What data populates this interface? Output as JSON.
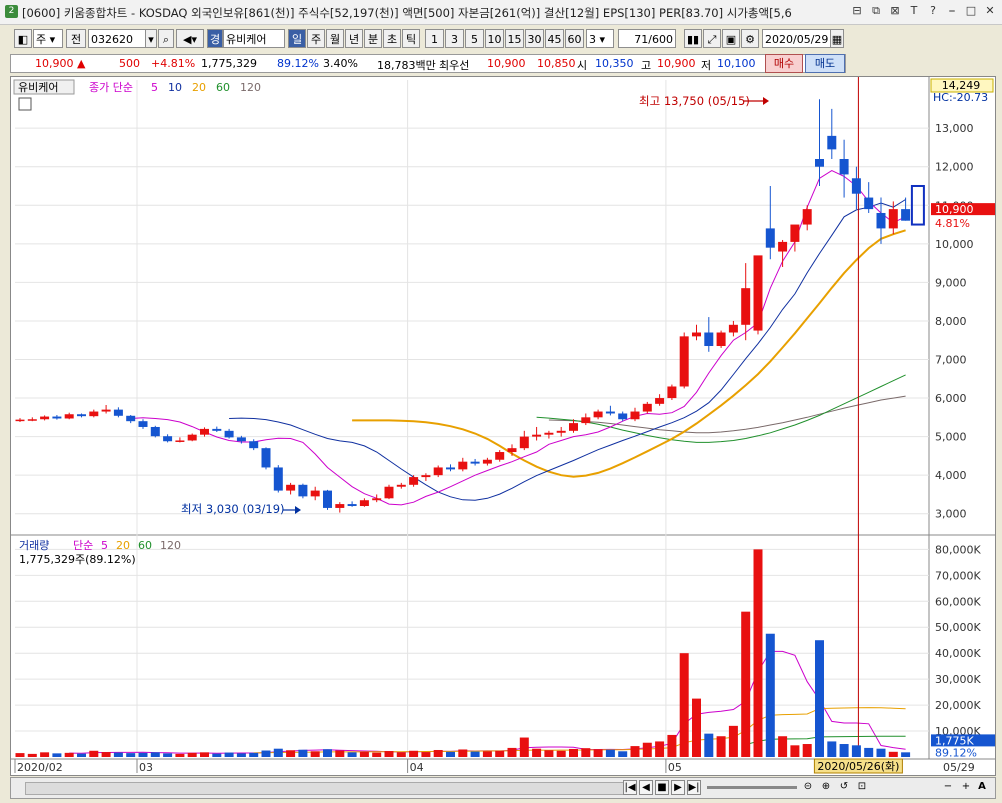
{
  "window": {
    "badge": "2",
    "title": "[0600] 키움종합차트 - KOSDAQ 외국인보유[861(천)] 주식수[52,197(천)] 액면[500] 자본금[261(억)] 결산[12월] EPS[130] PER[83.70] 시가총액[5,6",
    "buttons": [
      "⊟",
      "⧉",
      "⊠",
      "T",
      "?",
      "⎯",
      "□",
      "✕"
    ]
  },
  "toolbar": {
    "period_select": "주",
    "prev_label": "전",
    "code": "032620",
    "name": "유비케어",
    "name_prefix": "경",
    "timeframes": [
      "일",
      "주",
      "월",
      "년",
      "분",
      "초",
      "틱"
    ],
    "minutes": [
      "1",
      "3",
      "5",
      "10",
      "15",
      "30",
      "45",
      "60"
    ],
    "minute_value": "3",
    "count": "71",
    "count_max": "/600",
    "date": "2020/05/29"
  },
  "quote": {
    "price": "10,900",
    "arrow": "▲",
    "change": "500",
    "change_pct": "+4.81%",
    "volume": "1,775,329",
    "volume_ratio": "89.12%",
    "turnover": "3.40%",
    "amount": "18,783백만",
    "best_label": "최우선",
    "ask": "10,900",
    "bid": "10,850",
    "open_label": "시",
    "open": "10,350",
    "high_label": "고",
    "high": "10,900",
    "low_label": "저",
    "low": "10,100",
    "buy_label": "매수",
    "sell_label": "매도"
  },
  "price_panel": {
    "stock_tag": "유비케어",
    "ma_label": "종가 단순",
    "ma_periods": [
      "5",
      "10",
      "20",
      "60",
      "120"
    ],
    "ma_colors": [
      "#cc00cc",
      "#1030a0",
      "#e8a000",
      "#20902c",
      "#7a6a6a"
    ],
    "right_top": "14,249",
    "right_hc": "HC:-20.73",
    "current_tag": "10,900",
    "current_pct": "4.81%",
    "y_ticks": [
      "13,000",
      "12,000",
      "11,000",
      "10,000",
      "9,000",
      "8,000",
      "7,000",
      "6,000",
      "5,000",
      "4,000",
      "3,000"
    ],
    "high_note": "최고 13,750 (05/15)",
    "low_note": "최저 3,030 (03/19)"
  },
  "volume_panel": {
    "label": "거래량",
    "ma_label": "단순",
    "ma_periods": [
      "5",
      "20",
      "60",
      "120"
    ],
    "value_note": "1,775,329주(89.12%)",
    "y_ticks": [
      "80,000K",
      "70,000K",
      "60,000K",
      "50,000K",
      "40,000K",
      "30,000K",
      "20,000K",
      "10,000K"
    ],
    "current_tag": "1,775K",
    "current_pct": "89.12%"
  },
  "x_axis": {
    "labels": [
      "2020/02",
      "03",
      "04",
      "05"
    ],
    "crosshair_date": "2020/05/26(화)",
    "right_date": "05/29"
  },
  "colors": {
    "up": "#e81010",
    "down": "#1555d0",
    "crosshair": "#c00000"
  },
  "chart_data": {
    "type": "candlestick",
    "candles": [
      [
        5430,
        5480,
        5380,
        5440,
        1.5
      ],
      [
        5440,
        5500,
        5400,
        5450,
        1.2
      ],
      [
        5450,
        5550,
        5420,
        5520,
        1.8
      ],
      [
        5520,
        5560,
        5440,
        5470,
        1.4
      ],
      [
        5470,
        5620,
        5450,
        5580,
        1.6
      ],
      [
        5580,
        5600,
        5500,
        5530,
        1.3
      ],
      [
        5530,
        5700,
        5500,
        5650,
        2.4
      ],
      [
        5650,
        5820,
        5600,
        5700,
        1.9
      ],
      [
        5700,
        5760,
        5500,
        5540,
        1.7
      ],
      [
        5540,
        5560,
        5350,
        5400,
        1.5
      ],
      [
        5400,
        5450,
        5200,
        5250,
        1.6
      ],
      [
        5250,
        5280,
        4980,
        5010,
        1.8
      ],
      [
        5010,
        5060,
        4850,
        4880,
        1.4
      ],
      [
        4880,
        4980,
        4850,
        4900,
        1.2
      ],
      [
        4900,
        5080,
        4880,
        5050,
        1.6
      ],
      [
        5050,
        5240,
        5000,
        5200,
        1.8
      ],
      [
        5200,
        5260,
        5120,
        5150,
        1.3
      ],
      [
        5150,
        5200,
        4950,
        4980,
        1.7
      ],
      [
        4980,
        5020,
        4820,
        4880,
        1.4
      ],
      [
        4880,
        4930,
        4650,
        4700,
        1.6
      ],
      [
        4700,
        4720,
        4150,
        4200,
        2.5
      ],
      [
        4200,
        4260,
        3550,
        3600,
        3.2
      ],
      [
        3600,
        3800,
        3500,
        3750,
        2.6
      ],
      [
        3750,
        3780,
        3400,
        3450,
        2.8
      ],
      [
        3450,
        3700,
        3350,
        3600,
        2.2
      ],
      [
        3600,
        3620,
        3100,
        3150,
        3.0
      ],
      [
        3150,
        3300,
        3030,
        3250,
        2.5
      ],
      [
        3250,
        3320,
        3180,
        3200,
        1.8
      ],
      [
        3200,
        3400,
        3180,
        3350,
        2.0
      ],
      [
        3350,
        3500,
        3300,
        3400,
        1.7
      ],
      [
        3400,
        3750,
        3380,
        3700,
        2.3
      ],
      [
        3700,
        3800,
        3650,
        3750,
        1.8
      ],
      [
        3750,
        4000,
        3700,
        3950,
        2.4
      ],
      [
        3950,
        4050,
        3850,
        4000,
        1.9
      ],
      [
        4000,
        4250,
        3950,
        4200,
        2.7
      ],
      [
        4200,
        4280,
        4100,
        4150,
        2.0
      ],
      [
        4150,
        4450,
        4100,
        4350,
        2.9
      ],
      [
        4350,
        4420,
        4250,
        4300,
        2.1
      ],
      [
        4300,
        4450,
        4250,
        4400,
        2.2
      ],
      [
        4400,
        4650,
        4350,
        4600,
        2.4
      ],
      [
        4600,
        4800,
        4500,
        4700,
        3.5
      ],
      [
        4700,
        5150,
        4650,
        5000,
        7.5
      ],
      [
        5000,
        5250,
        4900,
        5050,
        3.2
      ],
      [
        5050,
        5150,
        4950,
        5100,
        2.6
      ],
      [
        5100,
        5250,
        5000,
        5150,
        2.4
      ],
      [
        5150,
        5450,
        5100,
        5350,
        3.1
      ],
      [
        5350,
        5600,
        5300,
        5500,
        3.4
      ],
      [
        5500,
        5700,
        5450,
        5650,
        3.0
      ],
      [
        5650,
        5800,
        5550,
        5600,
        2.8
      ],
      [
        5600,
        5650,
        5400,
        5450,
        2.2
      ],
      [
        5450,
        5750,
        5400,
        5650,
        4.2
      ],
      [
        5650,
        5900,
        5600,
        5850,
        5.5
      ],
      [
        5850,
        6100,
        5800,
        6000,
        6.0
      ],
      [
        6000,
        6350,
        5950,
        6300,
        8.5
      ],
      [
        6300,
        7700,
        6250,
        7600,
        40.0
      ],
      [
        7600,
        7900,
        7500,
        7700,
        22.5
      ],
      [
        7700,
        8100,
        7200,
        7350,
        9.0
      ],
      [
        7350,
        7750,
        7300,
        7700,
        8.0
      ],
      [
        7700,
        8000,
        7600,
        7900,
        12.0
      ],
      [
        7900,
        9500,
        7500,
        8850,
        56.0
      ],
      [
        7750,
        9600,
        7650,
        9700,
        80.0
      ],
      [
        10400,
        11500,
        9600,
        9900,
        47.5
      ],
      [
        9800,
        10100,
        9400,
        10050,
        8.0
      ],
      [
        10050,
        10350,
        9800,
        10500,
        4.5
      ],
      [
        10500,
        11000,
        10350,
        10900,
        5.0
      ],
      [
        12200,
        13750,
        11500,
        12000,
        45.0
      ],
      [
        12800,
        13500,
        12200,
        12450,
        6.0
      ],
      [
        12200,
        12700,
        11200,
        11800,
        5.0
      ],
      [
        11700,
        12000,
        10900,
        11300,
        4.5
      ],
      [
        11200,
        11600,
        10800,
        10900,
        3.5
      ],
      [
        10800,
        11200,
        10000,
        10400,
        3.2
      ],
      [
        10400,
        11100,
        10250,
        10900,
        2.0
      ],
      [
        10900,
        11200,
        10600,
        10600,
        1.8
      ]
    ],
    "ma5": [
      5470,
      5490,
      5470,
      5440,
      5380,
      5260,
      5120,
      4990,
      4900,
      4860,
      4860,
      4920,
      4960,
      4950,
      4850,
      4550,
      4200,
      3950,
      3700,
      3520,
      3400,
      3250,
      3230,
      3300,
      3450,
      3560,
      3700,
      3850,
      4000,
      4120,
      4240,
      4350,
      4480,
      4600,
      4800,
      4900,
      5000,
      5050,
      5120,
      5250,
      5400,
      5530,
      5600,
      5580,
      5620,
      5780,
      6150,
      6650,
      7100,
      7500,
      7700,
      7950,
      8850,
      9550,
      10050,
      10950,
      11700,
      11900,
      11750,
      11500,
      11100,
      10800,
      10550,
      10700
    ],
    "ma10": [
      5470,
      5480,
      5470,
      5440,
      5380,
      5300,
      5180,
      5060,
      4950,
      4890,
      4850,
      4760,
      4600,
      4380,
      4160,
      3950,
      3750,
      3560,
      3440,
      3360,
      3350,
      3400,
      3510,
      3660,
      3830,
      3990,
      4120,
      4250,
      4380,
      4520,
      4660,
      4780,
      4900,
      5010,
      5130,
      5250,
      5360,
      5490,
      5660,
      5880,
      6210,
      6610,
      7020,
      7410,
      7830,
      8300,
      8700,
      9250,
      9750,
      10220,
      10700,
      10880,
      10950,
      11060,
      10950,
      11150
    ],
    "ma20": [
      5420,
      5420,
      5420,
      5420,
      5410,
      5400,
      5370,
      5330,
      5270,
      5190,
      5080,
      4940,
      4760,
      4560,
      4380,
      4220,
      4090,
      4000,
      3960,
      3990,
      4060,
      4170,
      4310,
      4460,
      4620,
      4780,
      4940,
      5130,
      5340,
      5570,
      5810,
      6060,
      6330,
      6620,
      6950,
      7310,
      7680,
      8070,
      8460,
      8860,
      9240,
      9580,
      9890,
      10130,
      10250,
      10350
    ],
    "ma60": [
      5500,
      5480,
      5450,
      5420,
      5380,
      5320,
      5250,
      5170,
      5100,
      5030,
      4970,
      4920,
      4880,
      4850,
      4850,
      4870,
      4900,
      4950,
      5020,
      5100,
      5200,
      5300,
      5420,
      5550,
      5700,
      5850,
      6000,
      6150,
      6300,
      6450,
      6600
    ],
    "ma120": [
      5430,
      5420,
      5410,
      5390,
      5370,
      5340,
      5300,
      5260,
      5220,
      5180,
      5150,
      5120,
      5100,
      5100,
      5120,
      5150,
      5190,
      5240,
      5300,
      5360,
      5430,
      5500,
      5580,
      5660,
      5740,
      5810,
      5880,
      5950,
      6000,
      6050
    ],
    "price_range": [
      2500,
      14249
    ],
    "volume_range": [
      0,
      84000
    ]
  }
}
